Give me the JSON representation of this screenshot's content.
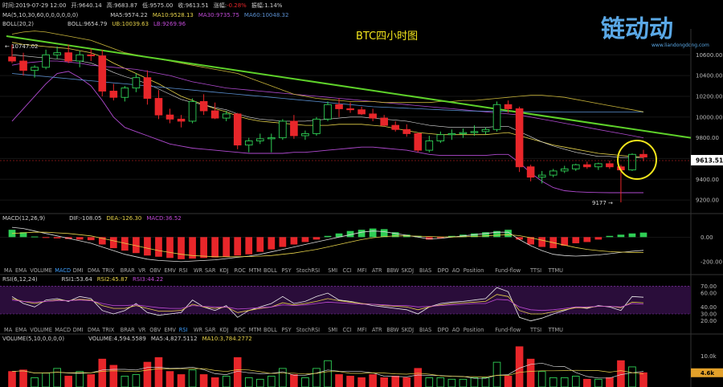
{
  "header": {
    "time_label": "时间:",
    "time": "2019-07-29 12:00",
    "open_label": "开:",
    "open": "9640.14",
    "high_label": "高:",
    "high": "9683.87",
    "low_label": "低:",
    "low": "9575.00",
    "close_label": "收:",
    "close": "9613.51",
    "change_label": "涨幅:",
    "change": "-0.28%",
    "amp_label": "振幅:",
    "amp": "1.14%"
  },
  "ma_row": {
    "title": "MA(5,10,30,60,0,0,0,0,0,0)",
    "ma5": "MA5:9574.22",
    "ma10": "MA10:9528.13",
    "ma30": "MA30:9735.75",
    "ma60": "MA60:10048.32"
  },
  "boll_row": {
    "title": "BOLL(20,2)",
    "boll": "BOLL:9654.79",
    "ub": "UB:10039.63",
    "lb": "LB:9269.96"
  },
  "chart_title": "BTC四小时图",
  "watermark": {
    "brand": "链动动",
    "url": "www.liandongdong.com"
  },
  "annotations": {
    "high_marker": "10747.02",
    "low_marker": "9177",
    "last_price": "9613.51"
  },
  "colors": {
    "up": "#2fce55",
    "down": "#e8262a",
    "trend": "#5ed12a",
    "ma_yellow": "#e6d24a",
    "purple": "#b04ad0",
    "blue": "#5a8fd0",
    "circle": "#f2e51c"
  },
  "indicator_tabs": [
    "MA",
    "EMA",
    "VOLUME",
    "MACD",
    "DMI",
    "DMA",
    "TRIX",
    "BRAR",
    "VR",
    "OBV",
    "EMV",
    "RSI",
    "WR",
    "SAR",
    "KDJ",
    "ROC",
    "MTM",
    "BOLL",
    "PSY",
    "StochRSI",
    "SMI",
    "CCI",
    "MFI",
    "ATR",
    "BBW",
    "SKDJ",
    "BIAS",
    "DPO",
    "AO",
    "Position",
    "Fund-flow",
    "TTSI",
    "TTMU"
  ],
  "macd_row": {
    "title": "MACD(12,26,9)",
    "dif": "DIF:-108.05",
    "dea": "DEA:-126.30",
    "macd": "MACD:36.52"
  },
  "rsi_row": {
    "title": "RSI(6,12,24)",
    "rsi1": "RSI1:53.64",
    "rsi2": "RSI2:45.87",
    "rsi3": "RSI3:44.22"
  },
  "volume_row": {
    "title": "VOLUME(5,10,0,0,0,0)",
    "volume": "VOLUME:4,594.5589",
    "ma5": "MA5:4,827.5112",
    "ma10": "MA10:3,784.2772"
  },
  "chart_data": [
    {
      "type": "candlestick",
      "title": "BTC四小时图",
      "y_ticks": [
        9200,
        9400,
        9600,
        9800,
        10000,
        10200,
        10400,
        10600
      ],
      "ylim": [
        9100,
        10850
      ],
      "candles": [
        [
          10580,
          10700,
          10520,
          10540
        ],
        [
          10540,
          10620,
          10400,
          10450
        ],
        [
          10450,
          10500,
          10380,
          10480
        ],
        [
          10480,
          10650,
          10460,
          10600
        ],
        [
          10600,
          10680,
          10560,
          10620
        ],
        [
          10620,
          10700,
          10520,
          10540
        ],
        [
          10540,
          10640,
          10480,
          10600
        ],
        [
          10600,
          10660,
          10540,
          10590
        ],
        [
          10590,
          10650,
          10200,
          10250
        ],
        [
          10250,
          10320,
          10160,
          10190
        ],
        [
          10190,
          10300,
          10150,
          10280
        ],
        [
          10280,
          10420,
          10240,
          10380
        ],
        [
          10380,
          10450,
          10120,
          10180
        ],
        [
          10180,
          10260,
          9980,
          10020
        ],
        [
          10020,
          10080,
          9940,
          9980
        ],
        [
          9980,
          10020,
          9900,
          9960
        ],
        [
          9960,
          10180,
          9940,
          10150
        ],
        [
          10150,
          10220,
          10020,
          10060
        ],
        [
          10060,
          10140,
          9980,
          9990
        ],
        [
          9990,
          10060,
          9960,
          10030
        ],
        [
          10030,
          10040,
          9690,
          9730
        ],
        [
          9730,
          9800,
          9660,
          9770
        ],
        [
          9770,
          9840,
          9740,
          9790
        ],
        [
          9790,
          9840,
          9660,
          9800
        ],
        [
          9800,
          9980,
          9780,
          9960
        ],
        [
          9960,
          10020,
          9790,
          9820
        ],
        [
          9820,
          9870,
          9780,
          9840
        ],
        [
          9840,
          10000,
          9820,
          9980
        ],
        [
          9980,
          10150,
          9960,
          10120
        ],
        [
          10120,
          10180,
          10000,
          10080
        ],
        [
          10080,
          10140,
          10040,
          10070
        ],
        [
          10070,
          10100,
          10020,
          10030
        ],
        [
          10030,
          10080,
          9960,
          9990
        ],
        [
          9990,
          10020,
          9910,
          9920
        ],
        [
          9920,
          9960,
          9860,
          9880
        ],
        [
          9880,
          9930,
          9810,
          9840
        ],
        [
          9840,
          9850,
          9660,
          9680
        ],
        [
          9680,
          9820,
          9660,
          9770
        ],
        [
          9770,
          9860,
          9750,
          9830
        ],
        [
          9830,
          9880,
          9780,
          9840
        ],
        [
          9840,
          9890,
          9800,
          9850
        ],
        [
          9850,
          9920,
          9820,
          9860
        ],
        [
          9860,
          9900,
          9830,
          9880
        ],
        [
          9880,
          10150,
          9860,
          10120
        ],
        [
          10120,
          10160,
          10040,
          10080
        ],
        [
          10080,
          10100,
          9470,
          9520
        ],
        [
          9520,
          9540,
          9380,
          9420
        ],
        [
          9420,
          9480,
          9360,
          9440
        ],
        [
          9440,
          9500,
          9420,
          9480
        ],
        [
          9480,
          9530,
          9460,
          9500
        ],
        [
          9500,
          9550,
          9480,
          9540
        ],
        [
          9540,
          9570,
          9500,
          9520
        ],
        [
          9520,
          9560,
          9490,
          9550
        ],
        [
          9550,
          9580,
          9500,
          9520
        ],
        [
          9520,
          9540,
          9177,
          9490
        ],
        [
          9490,
          9650,
          9480,
          9640
        ],
        [
          9640,
          9684,
          9575,
          9614
        ]
      ],
      "bands": {
        "ma_yellow": [
          10720,
          10700,
          10690,
          10680,
          10670,
          10660,
          10640,
          10620,
          10580,
          10520,
          10470,
          10420,
          10370,
          10320,
          10260,
          10200,
          10160,
          10120,
          10080,
          10050,
          10010,
          9980,
          9960,
          9950,
          9940,
          9930,
          9920,
          9920,
          9920,
          9930,
          9930,
          9930,
          9920,
          9910,
          9890,
          9870,
          9850,
          9840,
          9830,
          9830,
          9830,
          9830,
          9830,
          9840,
          9850,
          9820,
          9790,
          9760,
          9730,
          9710,
          9690,
          9670,
          9650,
          9640,
          9630,
          9620,
          9610
        ],
        "mid_white": [
          10600,
          10590,
          10580,
          10570,
          10560,
          10550,
          10540,
          10520,
          10480,
          10430,
          10390,
          10360,
          10320,
          10270,
          10220,
          10170,
          10140,
          10120,
          10090,
          10070,
          10030,
          10000,
          9980,
          9970,
          9960,
          9960,
          9960,
          9970,
          9980,
          9990,
          10000,
          10000,
          9990,
          9980,
          9970,
          9960,
          9940,
          9920,
          9910,
          9900,
          9900,
          9900,
          9900,
          9910,
          9910,
          9860,
          9810,
          9760,
          9720,
          9690,
          9660,
          9640,
          9620,
          9620,
          9610,
          9610,
          9610
        ],
        "ub_purple": [
          10500,
          10520,
          10530,
          10540,
          10540,
          10530,
          10520,
          10500,
          10490,
          10480,
          10470,
          10460,
          10440,
          10420,
          10400,
          10370,
          10340,
          10320,
          10300,
          10280,
          10270,
          10260,
          10250,
          10240,
          10230,
          10220,
          10210,
          10200,
          10190,
          10180,
          10170,
          10160,
          10150,
          10140,
          10130,
          10120,
          10110,
          10100,
          10090,
          10080,
          10070,
          10060,
          10050,
          10040,
          10030,
          10020,
          10000,
          9980,
          9960,
          9940,
          9920,
          9900,
          9880,
          9860,
          9840,
          9820,
          9800
        ],
        "lb_purple": [
          9960,
          10080,
          10200,
          10320,
          10420,
          10440,
          10380,
          10300,
          10160,
          10000,
          9900,
          9860,
          9820,
          9780,
          9740,
          9720,
          9700,
          9690,
          9680,
          9670,
          9660,
          9650,
          9650,
          9650,
          9650,
          9660,
          9660,
          9670,
          9680,
          9690,
          9700,
          9710,
          9710,
          9700,
          9690,
          9680,
          9660,
          9640,
          9630,
          9630,
          9630,
          9630,
          9630,
          9640,
          9640,
          9560,
          9460,
          9380,
          9320,
          9290,
          9280,
          9275,
          9272,
          9270,
          9270,
          9270,
          9270
        ],
        "ma60_blue": [
          10420,
          10410,
          10400,
          10390,
          10380,
          10370,
          10360,
          10350,
          10340,
          10330,
          10320,
          10310,
          10300,
          10290,
          10280,
          10270,
          10260,
          10250,
          10240,
          10230,
          10220,
          10210,
          10200,
          10190,
          10180,
          10170,
          10160,
          10150,
          10140,
          10130,
          10120,
          10110,
          10100,
          10095,
          10090,
          10085,
          10080,
          10075,
          10070,
          10065,
          10060,
          10058,
          10056,
          10055,
          10053,
          10052,
          10051,
          10050,
          10050,
          10049,
          10049,
          10049,
          10048,
          10048,
          10048,
          10048,
          10048
        ],
        "upper_yellow": [
          10800,
          10820,
          10830,
          10820,
          10800,
          10780,
          10760,
          10740,
          10700,
          10660,
          10620,
          10600,
          10580,
          10560,
          10540,
          10520,
          10500,
          10480,
          10460,
          10440,
          10420,
          10380,
          10340,
          10300,
          10260,
          10220,
          10200,
          10180,
          10170,
          10160,
          10150,
          10150,
          10150,
          10140,
          10140,
          10140,
          10140,
          10140,
          10150,
          10150,
          10160,
          10160,
          10170,
          10180,
          10190,
          10200,
          10210,
          10210,
          10200,
          10190,
          10170,
          10150,
          10130,
          10110,
          10090,
          10070,
          10050
        ]
      },
      "trendline": {
        "from": 10780,
        "to": 9800
      }
    },
    {
      "type": "bar",
      "title": "MACD(12,26,9)",
      "y_ticks": [
        0,
        -200
      ],
      "ylim": [
        -240,
        120
      ],
      "values": [
        60,
        40,
        5,
        -5,
        -10,
        -15,
        -20,
        -25,
        -60,
        -90,
        -110,
        -130,
        -150,
        -160,
        -170,
        -180,
        -175,
        -170,
        -165,
        -160,
        -150,
        -140,
        -120,
        -100,
        -80,
        -60,
        -40,
        -20,
        10,
        30,
        50,
        60,
        70,
        65,
        40,
        20,
        10,
        -20,
        -10,
        10,
        20,
        30,
        40,
        50,
        60,
        -20,
        -60,
        -80,
        -90,
        -70,
        -50,
        -40,
        -20,
        10,
        20,
        30,
        37
      ],
      "dif": [
        80,
        70,
        50,
        30,
        10,
        -10,
        -30,
        -50,
        -80,
        -110,
        -140,
        -160,
        -180,
        -190,
        -195,
        -200,
        -195,
        -190,
        -185,
        -175,
        -165,
        -155,
        -140,
        -120,
        -100,
        -80,
        -60,
        -40,
        -20,
        0,
        20,
        40,
        50,
        45,
        30,
        15,
        0,
        -15,
        -10,
        0,
        10,
        20,
        30,
        40,
        40,
        -20,
        -70,
        -110,
        -140,
        -150,
        -155,
        -150,
        -145,
        -135,
        -125,
        -115,
        -108
      ],
      "dea": [
        30,
        35,
        40,
        40,
        35,
        30,
        20,
        10,
        -10,
        -30,
        -50,
        -70,
        -90,
        -110,
        -125,
        -140,
        -150,
        -155,
        -160,
        -160,
        -160,
        -158,
        -155,
        -150,
        -140,
        -130,
        -115,
        -100,
        -80,
        -60,
        -40,
        -20,
        -5,
        5,
        10,
        10,
        8,
        5,
        2,
        1,
        3,
        6,
        10,
        15,
        20,
        12,
        -5,
        -25,
        -45,
        -65,
        -85,
        -100,
        -110,
        -118,
        -122,
        -124,
        -126
      ]
    },
    {
      "type": "line",
      "title": "RSI(6,12,24)",
      "y_ticks": [
        70,
        60,
        40,
        30,
        20
      ],
      "ylim": [
        15,
        75
      ],
      "series": [
        {
          "name": "RSI1",
          "values": [
            55,
            45,
            40,
            50,
            52,
            48,
            55,
            52,
            35,
            30,
            35,
            45,
            32,
            28,
            30,
            32,
            50,
            40,
            35,
            42,
            25,
            35,
            40,
            45,
            55,
            45,
            48,
            55,
            60,
            50,
            48,
            45,
            42,
            40,
            38,
            36,
            30,
            40,
            45,
            47,
            48,
            50,
            52,
            68,
            62,
            25,
            20,
            24,
            30,
            35,
            40,
            38,
            42,
            40,
            35,
            55,
            54
          ]
        },
        {
          "name": "RSI2",
          "values": [
            52,
            48,
            45,
            48,
            50,
            49,
            51,
            50,
            42,
            38,
            38,
            42,
            38,
            34,
            34,
            35,
            44,
            40,
            38,
            40,
            32,
            35,
            38,
            40,
            46,
            43,
            45,
            48,
            52,
            49,
            47,
            45,
            44,
            42,
            41,
            40,
            36,
            40,
            43,
            45,
            46,
            47,
            48,
            58,
            55,
            35,
            30,
            30,
            33,
            36,
            39,
            39,
            41,
            41,
            39,
            47,
            46
          ]
        },
        {
          "name": "RSI3",
          "values": [
            50,
            48,
            47,
            48,
            49,
            49,
            50,
            49,
            45,
            42,
            42,
            43,
            41,
            39,
            38,
            38,
            42,
            41,
            40,
            40,
            37,
            38,
            39,
            40,
            43,
            42,
            43,
            45,
            47,
            46,
            45,
            44,
            44,
            43,
            42,
            42,
            40,
            41,
            42,
            43,
            44,
            45,
            45,
            51,
            50,
            40,
            36,
            35,
            36,
            38,
            40,
            40,
            41,
            41,
            40,
            45,
            44
          ]
        }
      ]
    },
    {
      "type": "bar",
      "title": "VOLUME(5,10,0,0,0,0)",
      "y_ticks": [
        "10.0k",
        "5.0k"
      ],
      "ylim": [
        0,
        14000
      ],
      "last_volume_label": "4.6k",
      "values": [
        5000,
        5500,
        3000,
        4500,
        6000,
        3500,
        5000,
        4000,
        9000,
        7000,
        3500,
        4000,
        8000,
        9500,
        5000,
        4000,
        5500,
        4000,
        3000,
        3500,
        9500,
        3000,
        2500,
        3500,
        6000,
        4000,
        3000,
        6000,
        8500,
        4000,
        3500,
        3000,
        4000,
        3000,
        3500,
        3000,
        6000,
        3000,
        3000,
        2500,
        2500,
        3000,
        3000,
        8000,
        3500,
        13000,
        9000,
        5000,
        3000,
        3000,
        3500,
        2500,
        2500,
        3000,
        8500,
        6500,
        4600
      ]
    }
  ]
}
